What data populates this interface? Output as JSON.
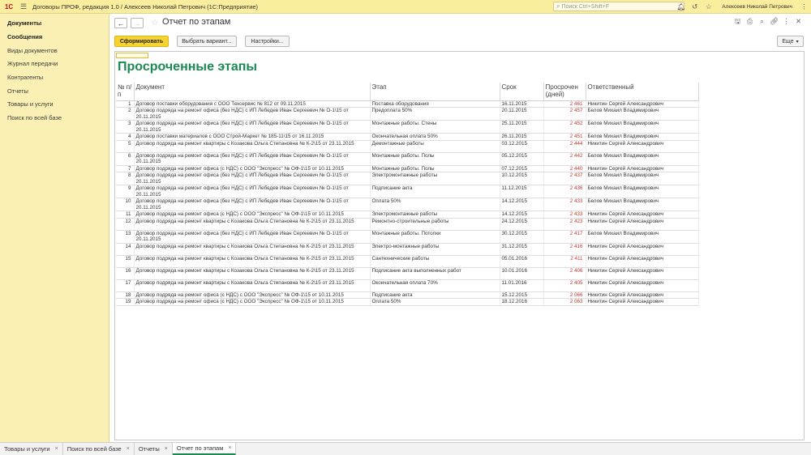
{
  "titlebar": {
    "logo": "1С",
    "app_title": "Договоры ПРОФ, редакция 1.0 / Алексеев Николай Петрович  (1С:Предприятие)",
    "search_placeholder": "Поиск Ctrl+Shift+F",
    "user_name": "Алексеев Николай Петрович"
  },
  "sidebar": {
    "items": [
      {
        "label": "Документы",
        "bold": true
      },
      {
        "label": "Сообщения",
        "bold": true
      },
      {
        "label": "Виды документов",
        "bold": false
      },
      {
        "label": "Журнал передачи",
        "bold": false
      },
      {
        "label": "Контрагенты",
        "bold": false
      },
      {
        "label": "Отчеты",
        "bold": false
      },
      {
        "label": "Товары и услуги",
        "bold": false
      },
      {
        "label": "Поиск по всей базе",
        "bold": false
      }
    ]
  },
  "header": {
    "title": "Отчет по этапам"
  },
  "toolbar": {
    "generate": "Сформировать",
    "choose_variant": "Выбрать вариант...",
    "settings": "Настройки...",
    "more": "Еще"
  },
  "report": {
    "title": "Просроченные этапы",
    "columns": {
      "num": "№ п/п",
      "document": "Документ",
      "stage": "Этап",
      "deadline": "Срок",
      "overdue": "Просрочен (дней)",
      "responsible": "Ответственный"
    },
    "rows": [
      {
        "n": "1",
        "doc": "Договор поставки оборудования с ООО Техсервис № 812 от 09.11.2015",
        "stage": "Поставка оборудования",
        "date": "16.11.2015",
        "days": "2 461",
        "resp": "Никитин Сергей Александрович"
      },
      {
        "n": "2",
        "doc": "Договор подряда на ремонт офиса (без НДС) с ИП Лебедев Иван Сергеевич № О-1\\15 от 20.11.2015",
        "stage": "Предоплата 50%",
        "date": "20.11.2015",
        "days": "2 457",
        "resp": "Белов Михаил Владимирович"
      },
      {
        "n": "3",
        "doc": "Договор подряда на ремонт офиса (без НДС) с ИП Лебедев Иван Сергеевич № О-1\\15 от 20.11.2015",
        "stage": "Монтажные работы. Стены",
        "date": "25.11.2015",
        "days": "2 452",
        "resp": "Белов Михаил Владимирович"
      },
      {
        "n": "4",
        "doc": "Договор поставки материалов с ООО Строй-Маркет № 185-11\\15 от 16.11.2015",
        "stage": "Окончательная оплата 50%",
        "date": "26.11.2015",
        "days": "2 451",
        "resp": "Белов Михаил Владимирович"
      },
      {
        "n": "5",
        "doc": "Договор подряда на ремонт квартиры с Козакова Ольга Степановна № К-2\\15 от 23.11.2015",
        "stage": "Демонтажные работы",
        "date": "03.12.2015",
        "days": "2 444",
        "resp": "Никитин Сергей Александрович"
      },
      {
        "n": "6",
        "doc": "Договор подряда на ремонт офиса (без НДС) с ИП Лебедев Иван Сергеевич № О-1\\15 от 20.11.2015",
        "stage": "Монтажные работы. Полы",
        "date": "05.12.2015",
        "days": "2 442",
        "resp": "Белов Михаил Владимирович"
      },
      {
        "n": "7",
        "doc": "Договор подряда на ремонт офиса (с НДС) с ООО \"Экспресс\" № ОФ-1\\15 от 10.11.2015",
        "stage": "Монтажные работы. Полы",
        "date": "07.12.2015",
        "days": "2 440",
        "resp": "Никитин Сергей Александрович"
      },
      {
        "n": "8",
        "doc": "Договор подряда на ремонт офиса (без НДС) с ИП Лебедев Иван Сергеевич № О-1\\15 от 20.11.2015",
        "stage": "Электромонтажные работы",
        "date": "10.12.2015",
        "days": "2 437",
        "resp": "Белов Михаил Владимирович"
      },
      {
        "n": "9",
        "doc": "Договор подряда на ремонт офиса (без НДС) с ИП Лебедев Иван Сергеевич № О-1\\15 от 20.11.2015",
        "stage": "Подписание акта",
        "date": "11.12.2015",
        "days": "2 436",
        "resp": "Белов Михаил Владимирович"
      },
      {
        "n": "10",
        "doc": "Договор подряда на ремонт офиса (без НДС) с ИП Лебедев Иван Сергеевич № О-1\\15 от 20.11.2015",
        "stage": "Оплата 50%",
        "date": "14.12.2015",
        "days": "2 433",
        "resp": "Белов Михаил Владимирович"
      },
      {
        "n": "11",
        "doc": "Договор подряда на ремонт офиса (с НДС) с ООО \"Экспресс\" № ОФ-1\\15 от 10.11.2015",
        "stage": "Электромонтажные работы",
        "date": "14.12.2015",
        "days": "2 433",
        "resp": "Никитин Сергей Александрович"
      },
      {
        "n": "12",
        "doc": "Договор подряда на ремонт квартиры с Козакова Ольга Степановна № К-2\\15 от 23.11.2015",
        "stage": "Ремонтно-строительные работы",
        "date": "24.12.2015",
        "days": "2 423",
        "resp": "Никитин Сергей Александрович"
      },
      {
        "n": "13",
        "doc": "Договор подряда на ремонт офиса (без НДС) с ИП Лебедев Иван Сергеевич № О-1\\15 от 20.11.2015",
        "stage": "Монтажные работы. Потолки",
        "date": "30.12.2015",
        "days": "2 417",
        "resp": "Белов Михаил Владимирович"
      },
      {
        "n": "14",
        "doc": "Договор подряда на ремонт квартиры с Козакова Ольга Степановна № К-2\\15 от 23.11.2015",
        "stage": "Электро-монтажные работы",
        "date": "31.12.2015",
        "days": "2 416",
        "resp": "Никитин Сергей Александрович"
      },
      {
        "n": "15",
        "doc": "Договор подряда на ремонт квартиры с Козакова Ольга Степановна № К-2\\15 от 23.11.2015",
        "stage": "Сантехнические работы",
        "date": "05.01.2016",
        "days": "2 411",
        "resp": "Никитин Сергей Александрович"
      },
      {
        "n": "16",
        "doc": "Договор подряда на ремонт квартиры с Козакова Ольга Степановна № К-2\\15 от 23.11.2015",
        "stage": "Подписание акта выполненных работ",
        "date": "10.01.2016",
        "days": "2 406",
        "resp": "Никитин Сергей Александрович"
      },
      {
        "n": "17",
        "doc": "Договор подряда на ремонт квартиры с Козакова Ольга Степановна № К-2\\15 от 23.11.2015",
        "stage": "Окончательная оплата 70%",
        "date": "11.01.2016",
        "days": "2 405",
        "resp": "Никитин Сергей Александрович"
      },
      {
        "n": "18",
        "doc": "Договор подряда на ремонт офиса (с НДС) с ООО \"Экспресс\" № ОФ-1\\15 от 10.11.2015",
        "stage": "Подписание акта",
        "date": "15.12.2015",
        "days": "2 066",
        "resp": "Никитин Сергей Александрович"
      },
      {
        "n": "19",
        "doc": "Договор подряда на ремонт офиса (с НДС) с ООО \"Экспресс\" № ОФ-1\\15 от 10.11.2015",
        "stage": "Оплата 50%",
        "date": "18.12.2016",
        "days": "2 063",
        "resp": "Никитин Сергей Александрович"
      }
    ]
  },
  "tabs": [
    {
      "label": "Товары и услуги",
      "active": false
    },
    {
      "label": "Поиск по всей базе",
      "active": false
    },
    {
      "label": "Отчеты",
      "active": false
    },
    {
      "label": "Отчет по этапам",
      "active": true
    }
  ],
  "colors": {
    "accent_green": "#1a8a52",
    "overdue_red": "#c0392b",
    "header_yellow": "#fbed9e",
    "primary_button": "#f7d330"
  }
}
